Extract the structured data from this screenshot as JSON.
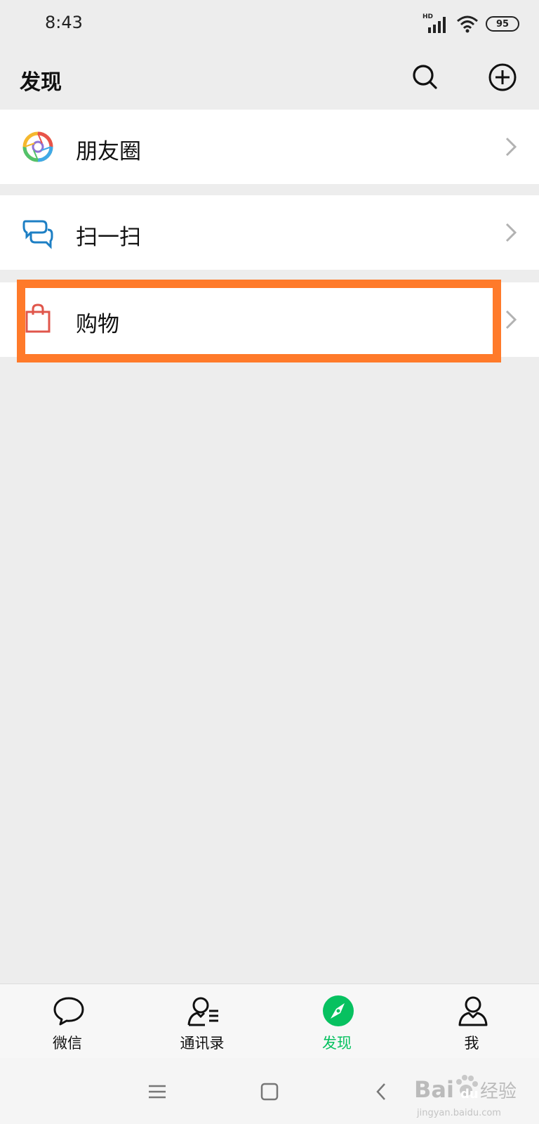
{
  "status_bar": {
    "time": "8:43",
    "network_label": "HD",
    "battery": "95",
    "icons": [
      "signal-icon",
      "wifi-icon",
      "battery-icon"
    ]
  },
  "header": {
    "title": "发现",
    "actions": [
      {
        "name": "search-icon"
      },
      {
        "name": "add-icon"
      }
    ]
  },
  "discover_items": [
    {
      "label": "朋友圈",
      "icon": "moments-icon"
    },
    {
      "label": "扫一扫",
      "icon": "scan-icon"
    },
    {
      "label": "购物",
      "icon": "shopping-bag-icon",
      "highlighted": true
    }
  ],
  "colors": {
    "background": "#ededed",
    "highlight": "#ff7a2a",
    "accent_green": "#07c160",
    "shopping_red": "#e0564b",
    "scan_blue": "#1d7fc4"
  },
  "tab_bar": {
    "tabs": [
      {
        "label": "微信",
        "icon": "chat-icon",
        "active": false
      },
      {
        "label": "通讯录",
        "icon": "contacts-icon",
        "active": false
      },
      {
        "label": "发现",
        "icon": "discover-compass-icon",
        "active": true
      },
      {
        "label": "我",
        "icon": "me-icon",
        "active": false
      }
    ]
  },
  "system_nav": {
    "buttons": [
      "menu-icon",
      "home-icon",
      "back-icon"
    ]
  },
  "watermark": {
    "line1": "Bai",
    "line1b": "du",
    "line1c": "经验",
    "line2": "jingyan.baidu.com"
  }
}
